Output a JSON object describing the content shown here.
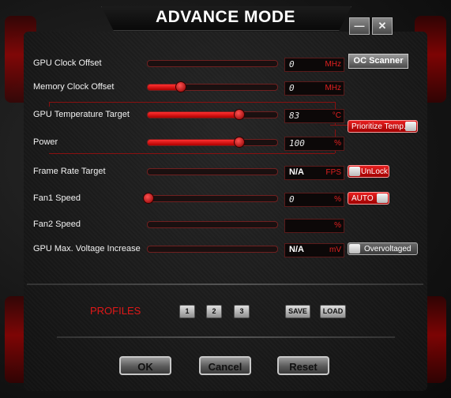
{
  "window": {
    "title": "ADVANCE MODE",
    "minimize_icon": "minimize-icon",
    "close_icon": "close-icon"
  },
  "oc_scanner_label": "OC Scanner",
  "controls": [
    {
      "label": "GPU Clock Offset",
      "value": "0",
      "unit": "MHz",
      "slider_fraction": 0.0
    },
    {
      "label": "Memory Clock Offset",
      "value": "0",
      "unit": "MHz",
      "slider_fraction": 0.25
    },
    {
      "label": "GPU Temperature Target",
      "value": "83",
      "unit": "°C",
      "slider_fraction": 0.7
    },
    {
      "label": "Power",
      "value": "100",
      "unit": "%",
      "slider_fraction": 0.7
    },
    {
      "label": "Frame Rate Target",
      "value": "N/A",
      "unit": "FPS",
      "slider_fraction": 0.0
    },
    {
      "label": "Fan1 Speed",
      "value": "0",
      "unit": "%",
      "slider_fraction": 0.0
    },
    {
      "label": "Fan2 Speed",
      "value": "",
      "unit": "%",
      "slider_fraction": 0.0
    },
    {
      "label": "GPU Max. Voltage Increase",
      "value": "N/A",
      "unit": "mV",
      "slider_fraction": 0.0
    }
  ],
  "toggles": {
    "prioritize_temp": "Prioritize Temp.",
    "unlock": "UnLock",
    "auto": "AUTO",
    "overvoltaged": "Overvoltaged"
  },
  "profiles": {
    "label": "PROFILES",
    "slots": [
      "1",
      "2",
      "3"
    ],
    "save": "SAVE",
    "load": "LOAD"
  },
  "footer": {
    "ok": "OK",
    "cancel": "Cancel",
    "reset": "Reset"
  },
  "colors": {
    "accent": "#e01818",
    "background": "#1a1a1a"
  }
}
